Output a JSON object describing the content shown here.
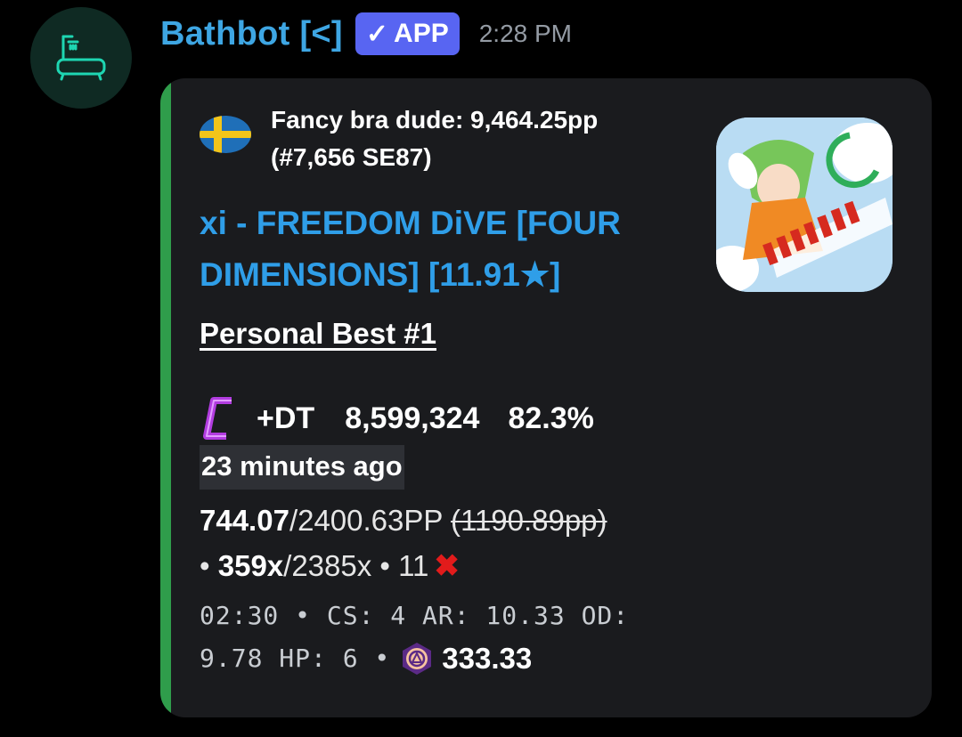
{
  "message": {
    "username": "Bathbot [<]",
    "badge_label": "APP",
    "timestamp": "2:28 PM"
  },
  "embed": {
    "accent_color": "#2f9d4b",
    "author_line1": "Fancy bra dude: 9,464.25pp",
    "author_line2": "(#7,656 SE87)",
    "title_line1": "xi - FREEDOM DiVE [FOUR",
    "title_line2": "DIMENSIONS] [11.91★]",
    "field_name": "Personal Best #1",
    "mods": "+DT",
    "score": "8,599,324",
    "accuracy": "82.3%",
    "time_ago": "23 minutes ago",
    "pp_achieved": "744.07",
    "pp_max": "/2400.63PP",
    "pp_if_fc": "(1190.89pp)",
    "combo_prefix": "•",
    "combo_achieved": "359x",
    "combo_max": "/2385x",
    "misses": "• 11",
    "stats_line1": "02:30 • CS: 4 AR: 10.33 OD:",
    "stats_line2": "9.78 HP: 6 •",
    "stars_value": "333.33"
  },
  "icons": {
    "avatar": "bathtub-shower-icon",
    "badge": "checkmark-icon",
    "flag": "sweden-flag-icon",
    "grade": "grade-c-icon",
    "miss": "cross-x-icon",
    "stars": "osu-stars-icon"
  }
}
